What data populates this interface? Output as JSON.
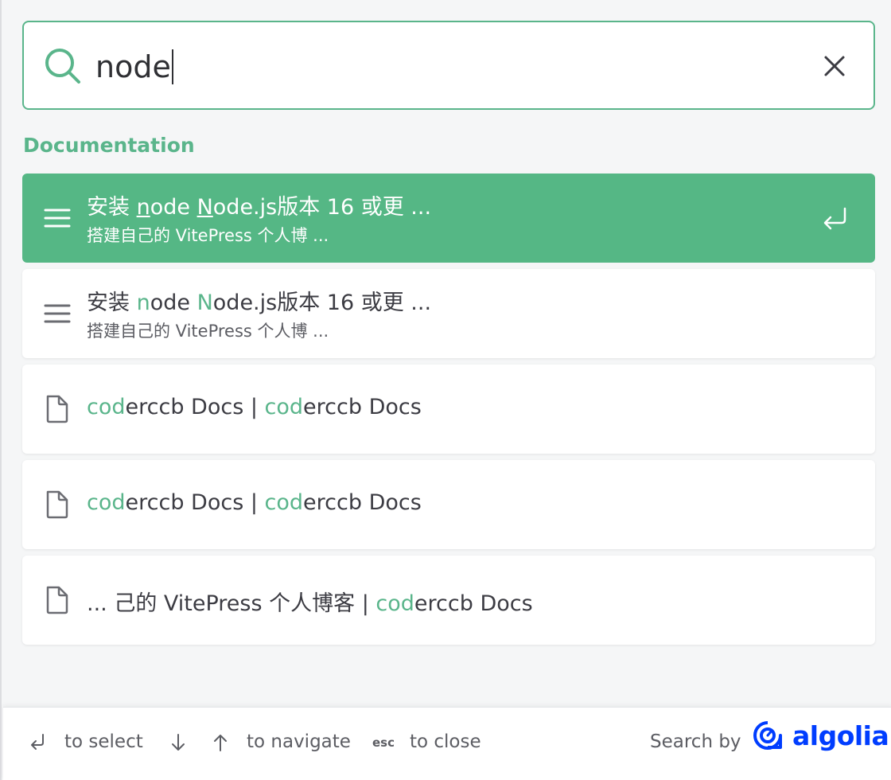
{
  "search": {
    "query": "node",
    "placeholder": ""
  },
  "section": {
    "title": "Documentation"
  },
  "hits": [
    {
      "title_parts": [
        "安装 ",
        "n",
        "ode ",
        "N",
        "ode.js版本 16 或更 ..."
      ],
      "path": "搭建自己的 VitePress 个人博 ...",
      "icon": "hash-lines-icon",
      "active": true
    },
    {
      "title_parts": [
        "安装 ",
        "n",
        "ode ",
        "N",
        "ode.js版本 16 或更 ..."
      ],
      "path": "搭建自己的 VitePress 个人博 ...",
      "icon": "hash-lines-icon",
      "active": false
    },
    {
      "title_parts": [
        "cod",
        "erccb Docs | ",
        "cod",
        "erccb Docs"
      ],
      "icon": "document-icon",
      "active": false
    },
    {
      "title_parts": [
        "cod",
        "erccb Docs | ",
        "cod",
        "erccb Docs"
      ],
      "icon": "document-icon",
      "active": false
    },
    {
      "title_parts": [
        "... 己的 VitePress 个人博客 | ",
        "cod",
        "erccb Docs"
      ],
      "icon": "document-icon",
      "active": false
    }
  ],
  "footer": {
    "select_label": "to select",
    "navigate_label": "to navigate",
    "esc_key": "esc",
    "close_label": "to close",
    "search_by": "Search by",
    "brand": "algolia"
  },
  "colors": {
    "accent": "#5ab58b",
    "active_bg": "#55b785",
    "algolia_blue": "#003dff"
  }
}
